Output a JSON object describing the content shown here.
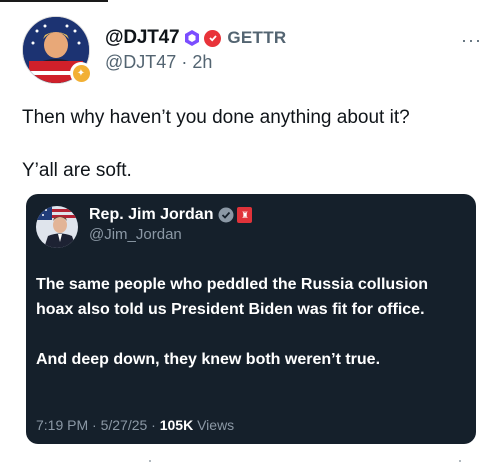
{
  "post": {
    "display_name": "@DJT47",
    "platform": "GETTR",
    "handle": "@DJT47",
    "separator": "·",
    "time": "2h",
    "text_line1": "Then why haven’t you done anything about it?",
    "text_line2": "Y’all are soft."
  },
  "quoted": {
    "name": "Rep. Jim Jordan",
    "handle": "@Jim_Jordan",
    "body_p1": "The same people who peddled the Russia collusion hoax also told us President Biden was fit for office.",
    "body_p2": "And deep down, they knew both weren’t true.",
    "timestamp": "7:19 PM · 5/27/25 ·",
    "views_count": "105K",
    "views_label": "Views"
  },
  "icons": {
    "more": "more-options-icon",
    "hex_badge": "hexagon-badge-icon",
    "red_badge": "red-check-badge-icon",
    "verified": "verified-icon",
    "flag": "affiliate-flag-icon"
  },
  "colors": {
    "accent_purple": "#7b4dff",
    "badge_red": "#e8333a",
    "card_bg": "#15202b",
    "muted": "#536471"
  }
}
